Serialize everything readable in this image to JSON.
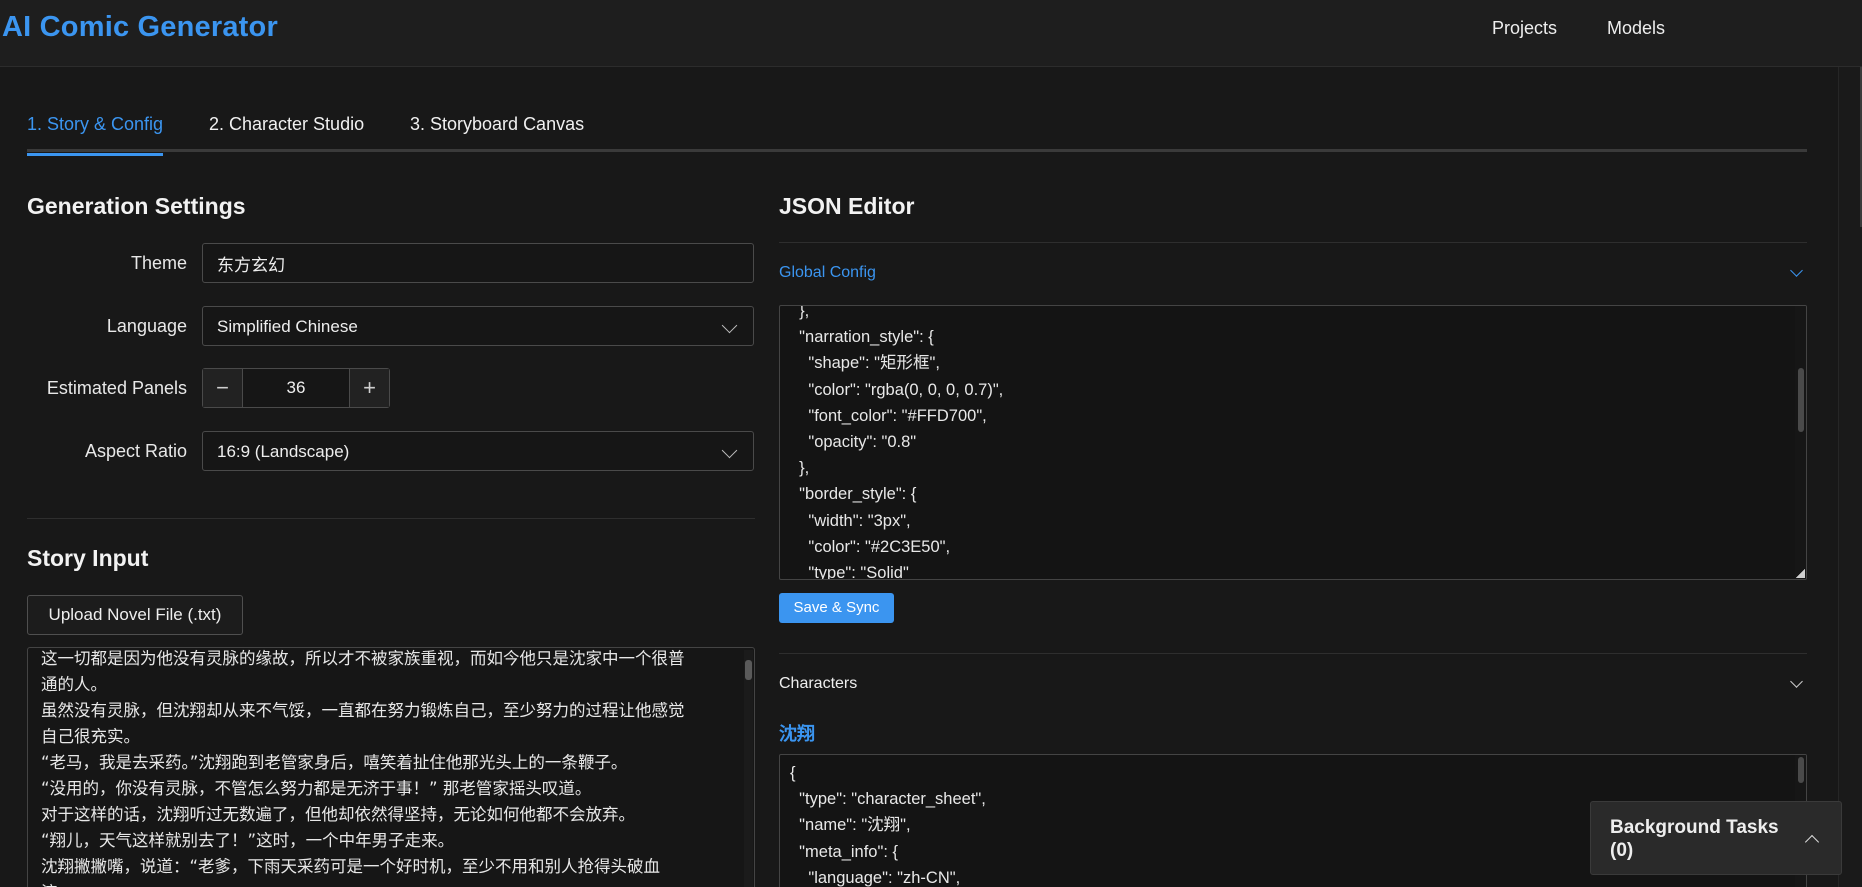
{
  "header": {
    "app_title": "AI Comic Generator",
    "nav": [
      "Projects",
      "Models"
    ]
  },
  "tabs": [
    {
      "label": "1. Story & Config",
      "active": true
    },
    {
      "label": "2. Character Studio",
      "active": false
    },
    {
      "label": "3. Storyboard Canvas",
      "active": false
    }
  ],
  "settings": {
    "title": "Generation Settings",
    "theme": {
      "label": "Theme",
      "value": "东方玄幻"
    },
    "language": {
      "label": "Language",
      "value": "Simplified Chinese"
    },
    "panels": {
      "label": "Estimated Panels",
      "value": "36",
      "minus": "−",
      "plus": "+"
    },
    "aspect": {
      "label": "Aspect Ratio",
      "value": "16:9 (Landscape)"
    }
  },
  "story": {
    "title": "Story Input",
    "upload_label": "Upload Novel File (.txt)",
    "text": "这一切都是因为他没有灵脉的缘故，所以才不被家族重视，而如今他只是沈家中一个很普\n通的人。\n虽然没有灵脉，但沈翔却从来不气馁，一直都在努力锻炼自己，至少努力的过程让他感觉\n自己很充实。\n“老马，我是去采药。”沈翔跑到老管家身后，嘻笑着扯住他那光头上的一条鞭子。\n“没用的，你没有灵脉，不管怎么努力都是无济于事！” 那老管家摇头叹道。\n对于这样的话，沈翔听过无数遍了，但他却依然得坚持，无论如何他都不会放弃。\n“翔儿，天气这样就别去了！”这时，一个中年男子走来。\n沈翔撇撇嘴，说道：“老爹，下雨天采药可是一个好时机，至少不用和别人抢得头破血\n流。"
  },
  "json_editor": {
    "title": "JSON Editor",
    "global_config_label": "Global Config",
    "global_config_code": "  },\n  \"narration_style\": {\n    \"shape\": \"矩形框\",\n    \"color\": \"rgba(0, 0, 0, 0.7)\",\n    \"font_color\": \"#FFD700\",\n    \"opacity\": \"0.8\"\n  },\n  \"border_style\": {\n    \"width\": \"3px\",\n    \"color\": \"#2C3E50\",\n    \"type\": \"Solid\"",
    "save_label": "Save & Sync",
    "characters_label": "Characters",
    "character_name": "沈翔",
    "character_code": "{\n  \"type\": \"character_sheet\",\n  \"name\": \"沈翔\",\n  \"meta_info\": {\n    \"language\": \"zh-CN\","
  },
  "background_tasks": {
    "label": "Background Tasks (0)"
  },
  "colors": {
    "accent": "#3b95f0",
    "background": "#181818"
  }
}
